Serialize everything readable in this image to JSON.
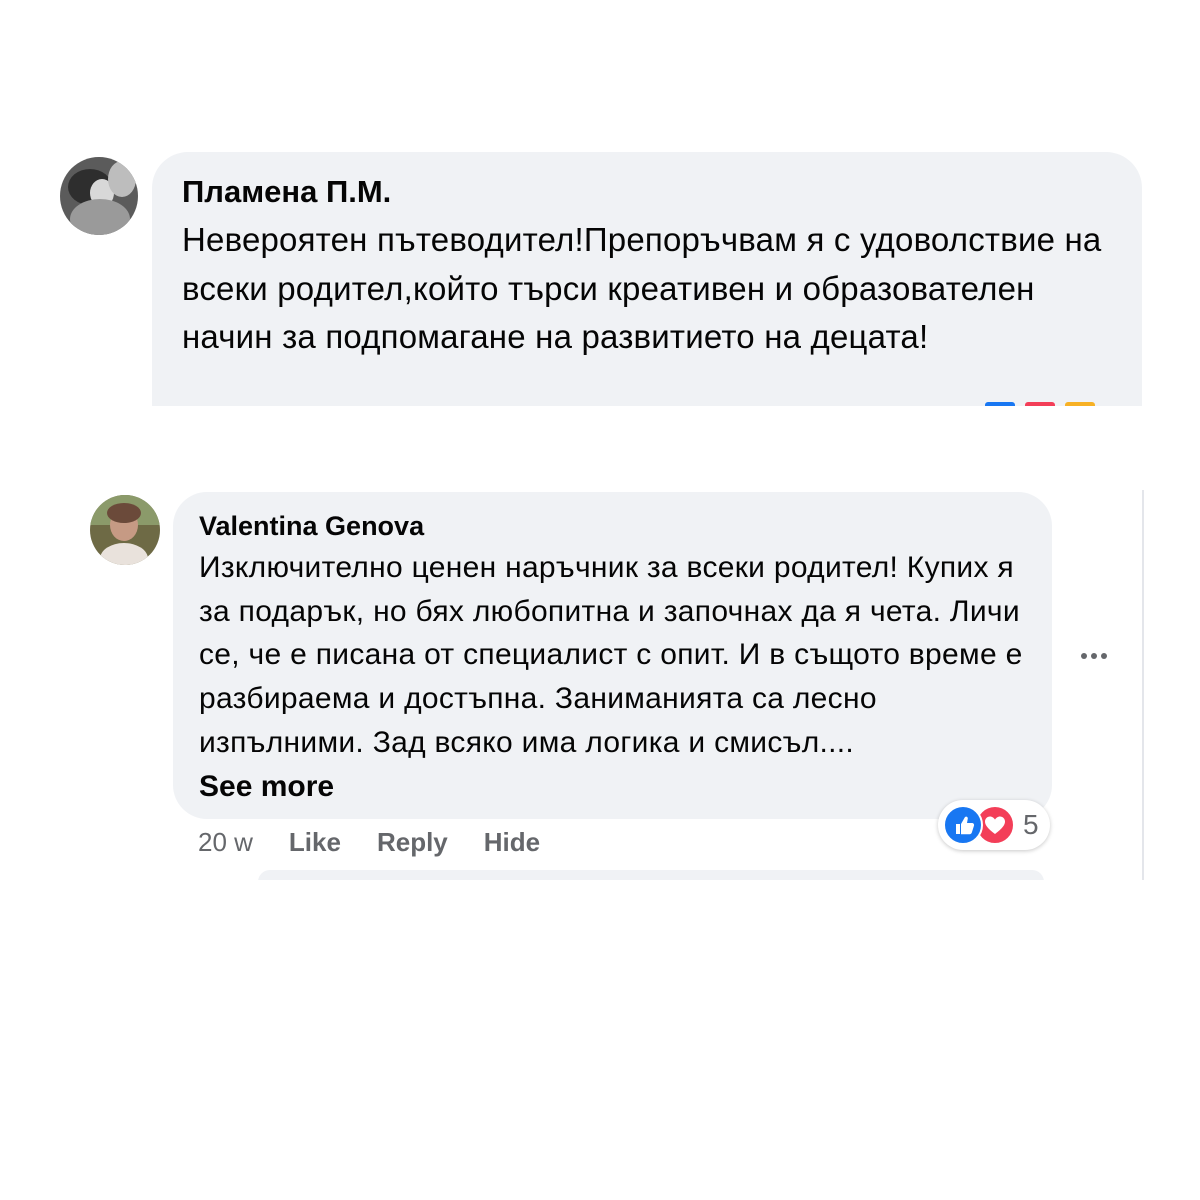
{
  "comments": [
    {
      "author": "Пламена П.М.",
      "text": "Невероятен пътеводител!Препоръчвам я с удоволствие на всеки родител,който търси креативен и образователен начин за подпомагане на развитието на децата!",
      "avatar_icon": "user-avatar"
    },
    {
      "author": "Valentina Genova",
      "text": "Изключително ценен наръчник за всеки родител! Купих я за подарък, но бях любопитна и започнах да я чета. Личи се, че е писана от специалист с опит. И в същото време е разбираема и достъпна. Заниманията са лесно изпълними. Зад всяко има логика и смисъл....",
      "see_more": "See more",
      "time": "20 w",
      "actions": {
        "like": "Like",
        "reply": "Reply",
        "hide": "Hide"
      },
      "reactions": {
        "count": "5",
        "types": [
          "like",
          "love"
        ]
      },
      "avatar_icon": "user-avatar"
    }
  ],
  "colors": {
    "bubble": "#f0f2f5",
    "secondary_text": "#65676b",
    "like_blue": "#1877f2",
    "love_red": "#f33e58"
  }
}
